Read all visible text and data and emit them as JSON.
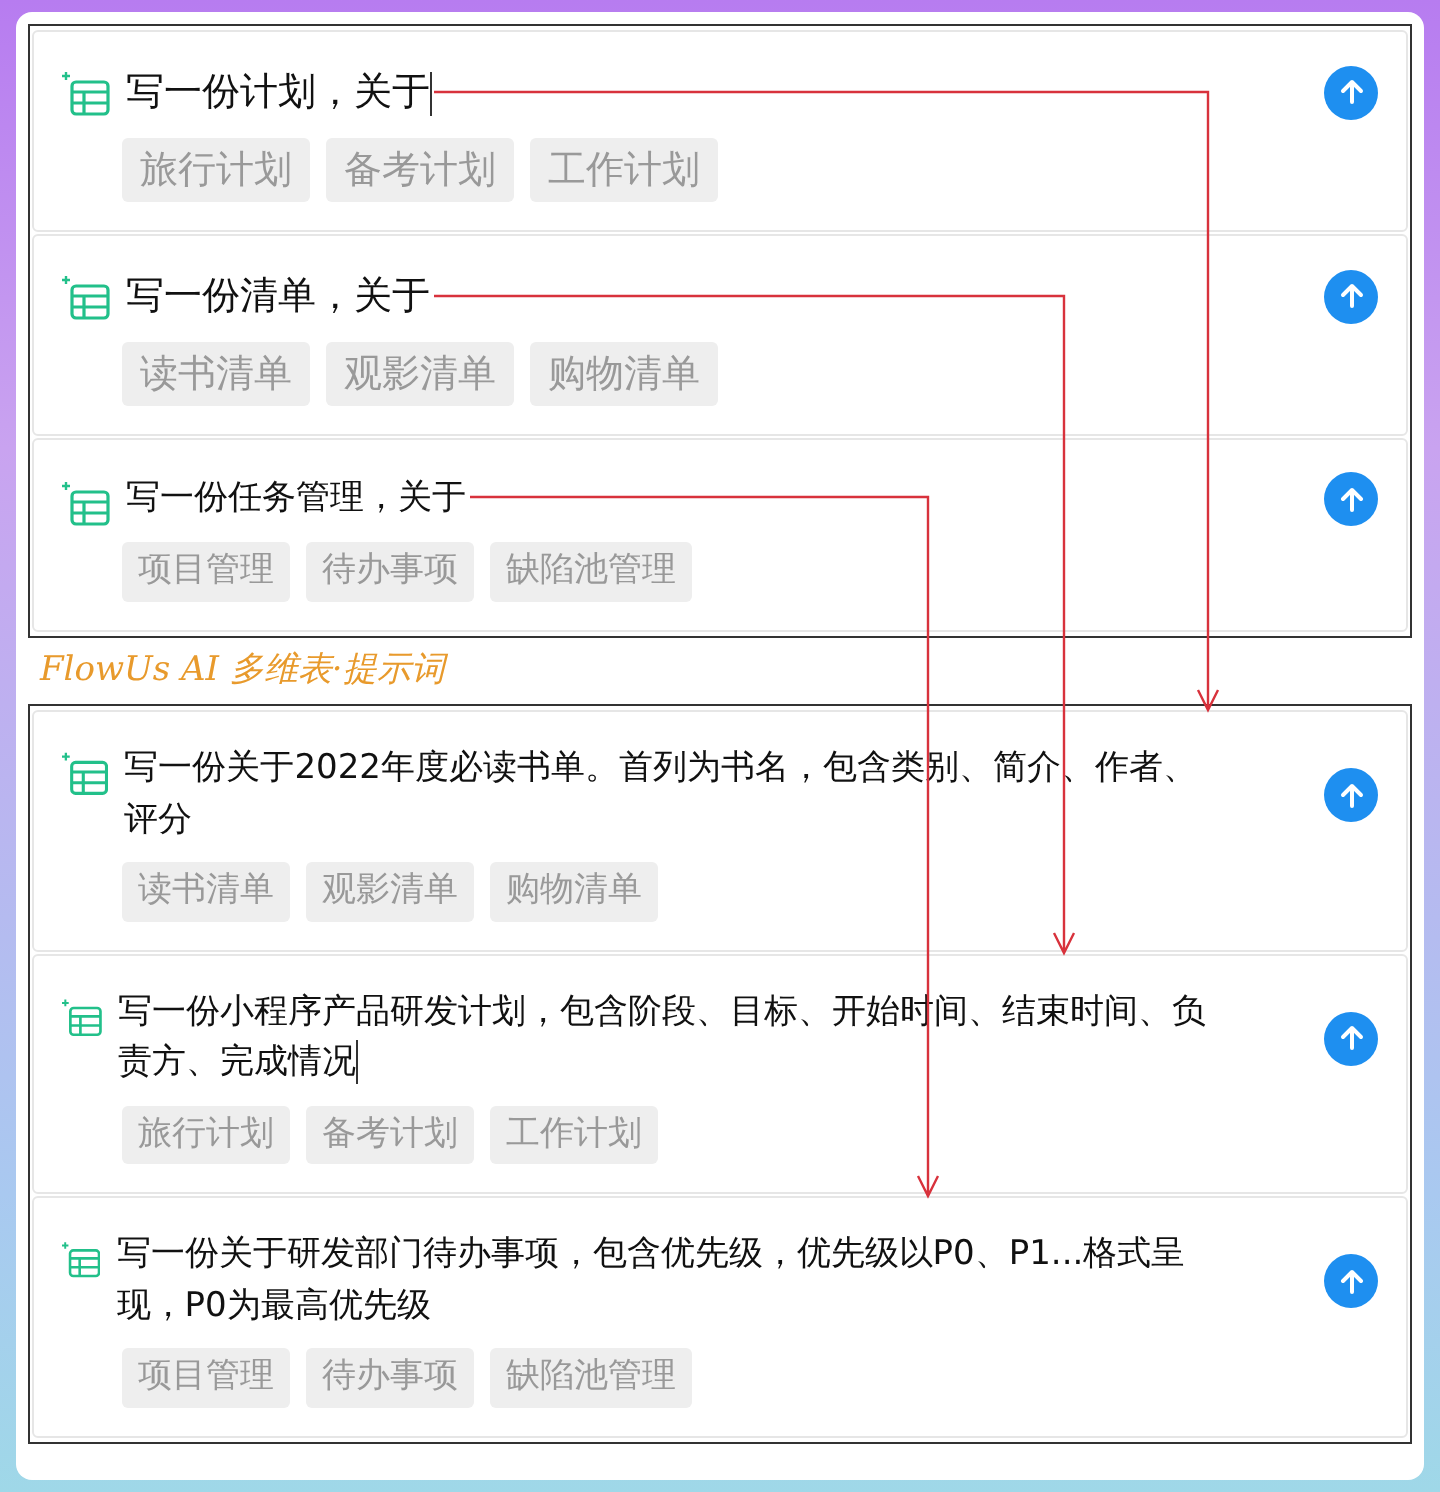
{
  "groups": [
    {
      "cards": [
        {
          "prompt": "写一份计划，关于",
          "caret": true,
          "linked": true,
          "chips": [
            "旅行计划",
            "备考计划",
            "工作计划"
          ]
        },
        {
          "prompt": "写一份清单，关于",
          "caret": false,
          "linked": true,
          "chips": [
            "读书清单",
            "观影清单",
            "购物清单"
          ]
        },
        {
          "prompt": "写一份任务管理，关于",
          "caret": false,
          "linked": true,
          "chips": [
            "项目管理",
            "待办事项",
            "缺陷池管理"
          ]
        }
      ]
    },
    {
      "cards": [
        {
          "prompt": "写一份关于2022年度必读书单。首列为书名，包含类别、简介、作者、评分",
          "caret": false,
          "chips": [
            "读书清单",
            "观影清单",
            "购物清单"
          ]
        },
        {
          "prompt": "写一份小程序产品研发计划，包含阶段、目标、开始时间、结束时间、负责方、完成情况",
          "caret": true,
          "chips": [
            "旅行计划",
            "备考计划",
            "工作计划"
          ]
        },
        {
          "prompt": "写一份关于研发部门待办事项，包含优先级，优先级以P0、P1...格式呈现，P0为最高优先级",
          "caret": false,
          "chips": [
            "项目管理",
            "待办事项",
            "缺陷池管理"
          ]
        }
      ]
    }
  ],
  "caption": "FlowUs AI 多维表·提示词"
}
